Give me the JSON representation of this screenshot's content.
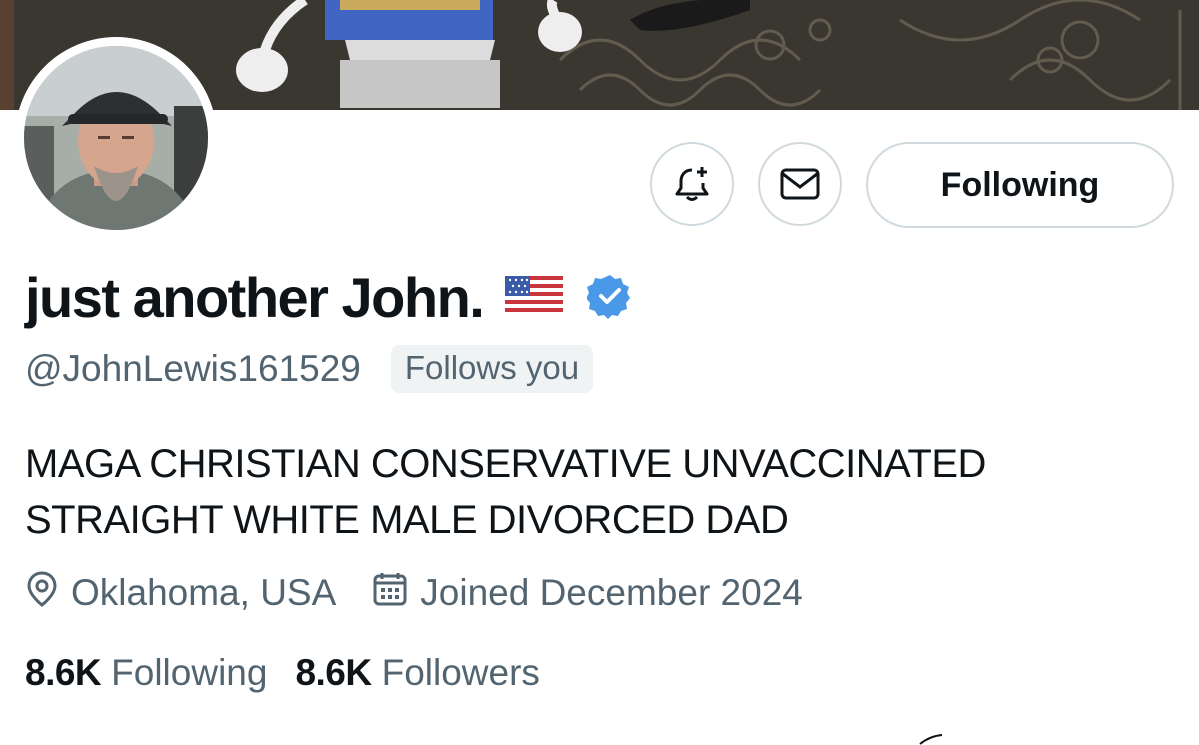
{
  "banner": {
    "image": "desk-with-figurine-photo"
  },
  "avatar": {
    "image": "profile-photo-man-with-cap"
  },
  "actions": {
    "notify_icon": "bell-plus-icon",
    "message_icon": "envelope-icon",
    "follow_label": "Following"
  },
  "profile": {
    "display_name": "just another John.",
    "flag_icon": "us-flag-icon",
    "verified_icon": "verified-badge-icon",
    "verified_color": "#4a99e9",
    "handle": "@JohnLewis161529",
    "follows_badge": "Follows you",
    "bio_line1": "MAGA CHRISTIAN CONSERVATIVE UNVACCINATED",
    "bio_line2": "STRAIGHT WHITE MALE DIVORCED DAD",
    "location_icon": "location-pin-icon",
    "location": "Oklahoma, USA",
    "joined_icon": "calendar-icon",
    "joined": "Joined December 2024"
  },
  "stats": {
    "following_count": "8.6K",
    "following_label": "Following",
    "followers_count": "8.6K",
    "followers_label": "Followers"
  },
  "colors": {
    "text_primary": "#0f1419",
    "text_secondary": "#536471",
    "border": "#cfd9de",
    "badge_bg": "#eff3f4"
  }
}
